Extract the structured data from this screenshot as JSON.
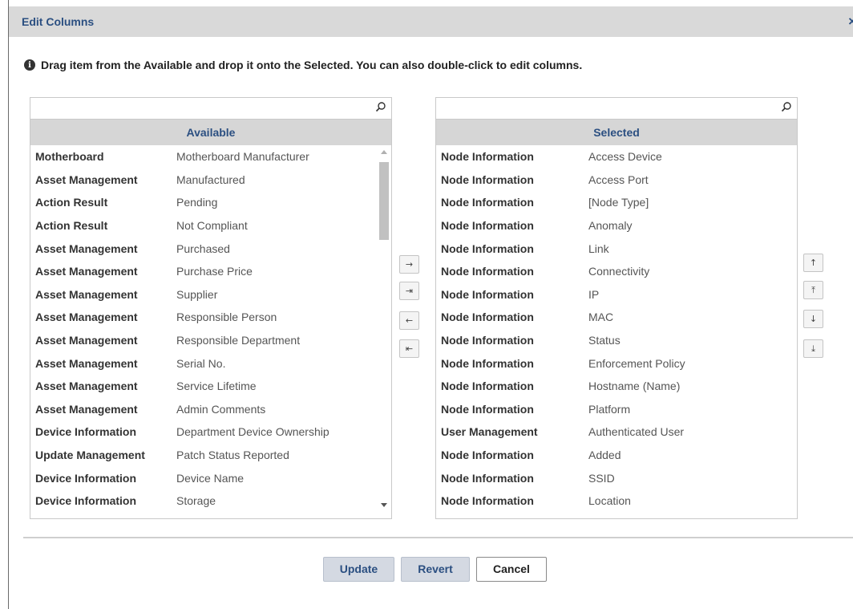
{
  "dialog": {
    "title": "Edit Columns",
    "close_glyph": "×",
    "info_icon_glyph": "i",
    "info_text": "Drag item from the Available and drop it onto the Selected. You can also double-click to edit columns."
  },
  "available": {
    "header": "Available",
    "search_value": "",
    "search_icon": "search-icon",
    "items": [
      {
        "category": "Motherboard",
        "name": "Motherboard Manufacturer"
      },
      {
        "category": "Asset Management",
        "name": "Manufactured"
      },
      {
        "category": "Action Result",
        "name": "Pending"
      },
      {
        "category": "Action Result",
        "name": "Not Compliant"
      },
      {
        "category": "Asset Management",
        "name": "Purchased"
      },
      {
        "category": "Asset Management",
        "name": "Purchase Price"
      },
      {
        "category": "Asset Management",
        "name": "Supplier"
      },
      {
        "category": "Asset Management",
        "name": "Responsible Person"
      },
      {
        "category": "Asset Management",
        "name": "Responsible Department"
      },
      {
        "category": "Asset Management",
        "name": "Serial No."
      },
      {
        "category": "Asset Management",
        "name": "Service Lifetime"
      },
      {
        "category": "Asset Management",
        "name": "Admin Comments"
      },
      {
        "category": "Device Information",
        "name": "Department Device Ownership"
      },
      {
        "category": "Update Management",
        "name": "Patch Status Reported"
      },
      {
        "category": "Device Information",
        "name": "Device Name"
      },
      {
        "category": "Device Information",
        "name": "Storage"
      }
    ]
  },
  "selected": {
    "header": "Selected",
    "search_value": "",
    "search_icon": "search-icon",
    "items": [
      {
        "category": "Node Information",
        "name": "Access Device"
      },
      {
        "category": "Node Information",
        "name": "Access Port"
      },
      {
        "category": "Node Information",
        "name": "[Node Type]"
      },
      {
        "category": "Node Information",
        "name": "Anomaly"
      },
      {
        "category": "Node Information",
        "name": "Link"
      },
      {
        "category": "Node Information",
        "name": "Connectivity"
      },
      {
        "category": "Node Information",
        "name": "IP"
      },
      {
        "category": "Node Information",
        "name": "MAC"
      },
      {
        "category": "Node Information",
        "name": "Status"
      },
      {
        "category": "Node Information",
        "name": "Enforcement Policy"
      },
      {
        "category": "Node Information",
        "name": "Hostname (Name)"
      },
      {
        "category": "Node Information",
        "name": "Platform"
      },
      {
        "category": "User Management",
        "name": "Authenticated User"
      },
      {
        "category": "Node Information",
        "name": "Added"
      },
      {
        "category": "Node Information",
        "name": "SSID"
      },
      {
        "category": "Node Information",
        "name": "Location"
      }
    ]
  },
  "transfer_buttons": {
    "move_right": "→",
    "move_all_right": "⇥",
    "move_left": "←",
    "move_all_left": "⇤"
  },
  "order_buttons": {
    "move_up": "↑",
    "move_top": "⤒",
    "move_down": "↓",
    "move_bottom": "⤓"
  },
  "footer": {
    "update_label": "Update",
    "revert_label": "Revert",
    "cancel_label": "Cancel"
  }
}
